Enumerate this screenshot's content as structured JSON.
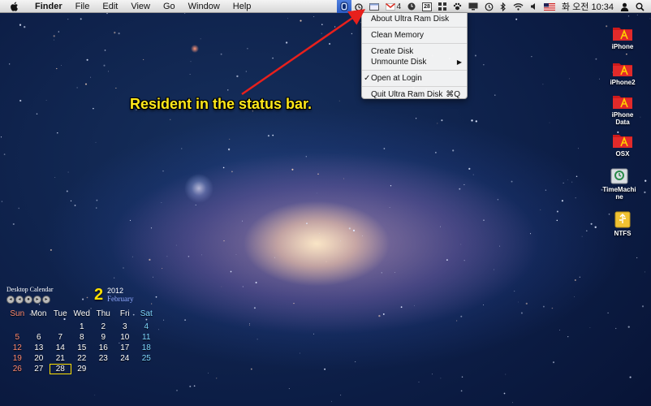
{
  "menubar": {
    "apple_icon": "apple-logo-icon",
    "app_name": "Finder",
    "menus": [
      "File",
      "Edit",
      "View",
      "Go",
      "Window",
      "Help"
    ],
    "status": {
      "calendar_day": "28",
      "mail_count": "4",
      "input_language": "한",
      "clock": "화 오전 10:34"
    }
  },
  "dropdown": {
    "items": [
      {
        "label": "About Ultra Ram Disk"
      },
      {
        "label": "Clean Memory"
      },
      {
        "label": "Create Disk"
      },
      {
        "label": "Unmounte Disk",
        "submenu_indicator": "▶"
      },
      {
        "label": "Open at Login",
        "check": "✓"
      },
      {
        "label": "Quit Ultra Ram Disk",
        "shortcut": "⌘Q"
      }
    ]
  },
  "callout": "Resident in the status bar.",
  "desktop_icons": [
    {
      "label": "iPhone"
    },
    {
      "label": "iPhone2"
    },
    {
      "label": "iPhone Data"
    },
    {
      "label": "OSX"
    },
    {
      "label": "TimeMachine"
    },
    {
      "label": "NTFS"
    }
  ],
  "calendar": {
    "title": "Desktop Calendar",
    "day_number": "2",
    "year": "2012",
    "month": "February",
    "weekdays": [
      "Sun",
      "Mon",
      "Tue",
      "Wed",
      "Thu",
      "Fri",
      "Sat"
    ],
    "weeks": [
      [
        "",
        "",
        "",
        "1",
        "2",
        "3",
        "4"
      ],
      [
        "5",
        "6",
        "7",
        "8",
        "9",
        "10",
        "11"
      ],
      [
        "12",
        "13",
        "14",
        "15",
        "16",
        "17",
        "18"
      ],
      [
        "19",
        "20",
        "21",
        "22",
        "23",
        "24",
        "25"
      ],
      [
        "26",
        "27",
        "28",
        "29",
        "",
        "",
        ""
      ]
    ],
    "today": "28"
  },
  "colors": {
    "callout": "#ffe81a",
    "arrow": "#e8201c",
    "menu_highlight": "#2a5bc4"
  }
}
